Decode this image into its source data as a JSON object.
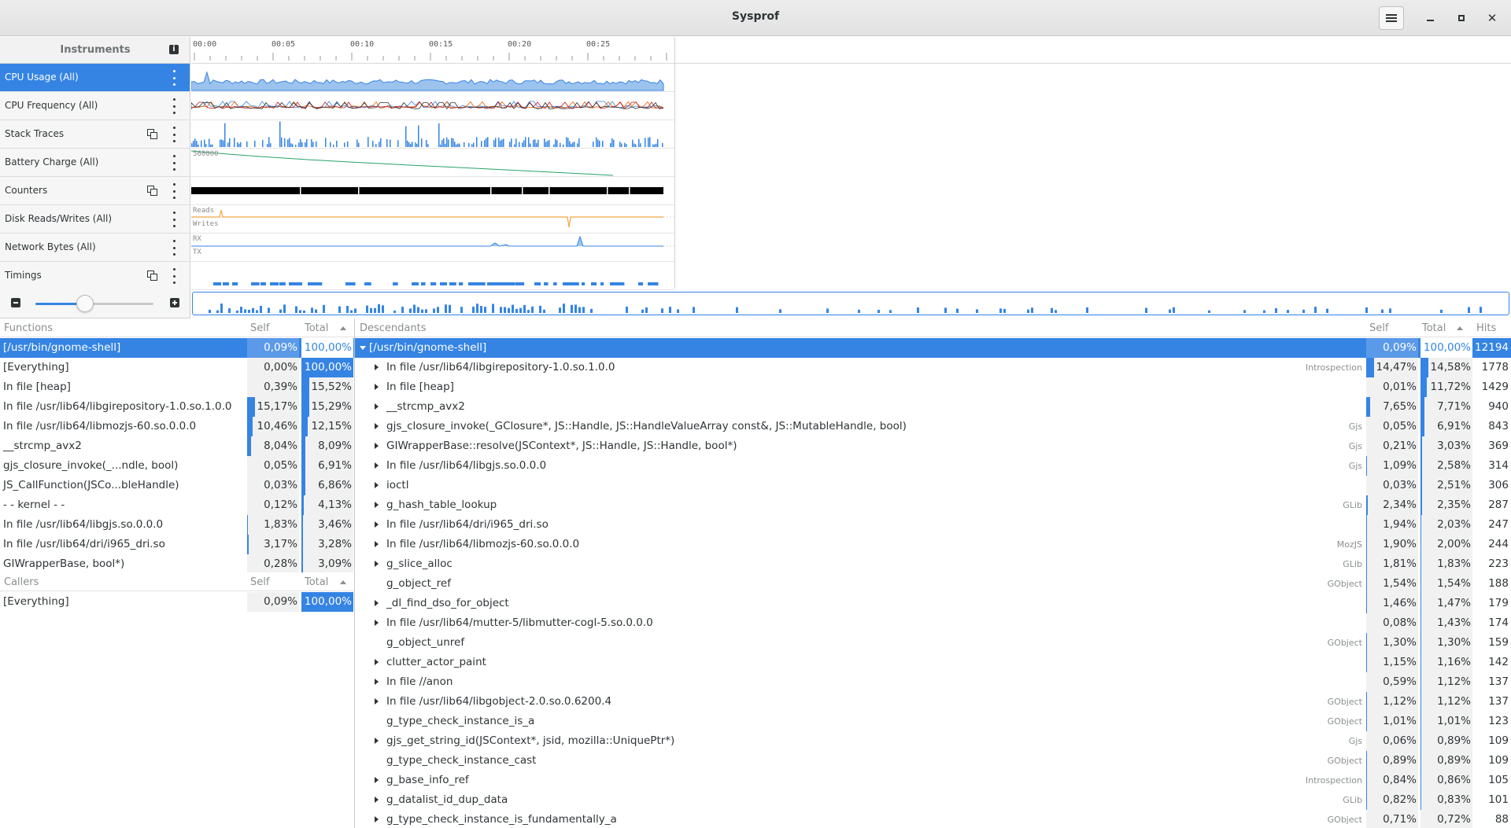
{
  "window": {
    "title": "Sysprof"
  },
  "instruments": {
    "header": "Instruments",
    "rows": [
      {
        "label": "CPU Usage (All)",
        "selected": true,
        "has_dup": false
      },
      {
        "label": "CPU Frequency (All)",
        "selected": false,
        "has_dup": false
      },
      {
        "label": "Stack Traces",
        "selected": false,
        "has_dup": true
      },
      {
        "label": "Battery Charge (All)",
        "selected": false,
        "has_dup": false
      },
      {
        "label": "Counters",
        "selected": false,
        "has_dup": true
      },
      {
        "label": "Disk Reads/Writes (All)",
        "selected": false,
        "has_dup": false
      },
      {
        "label": "Network Bytes (All)",
        "selected": false,
        "has_dup": false
      },
      {
        "label": "Timings",
        "selected": false,
        "has_dup": true
      }
    ]
  },
  "ruler": {
    "ticks": [
      "00:00",
      "00:05",
      "00:10",
      "00:15",
      "00:20",
      "00:25"
    ]
  },
  "graph_labels": {
    "battery": "560000",
    "reads": "Reads",
    "writes": "Writes",
    "rx": "RX",
    "tx": "TX"
  },
  "zoom": {
    "level": 0.42
  },
  "colors": {
    "accent": "#3584e4",
    "battery": "#26a269",
    "disk": "#f5a442"
  },
  "functions": {
    "headers": {
      "name": "Functions",
      "self": "Self",
      "total": "Total"
    },
    "rows": [
      {
        "name": "[/usr/bin/gnome-shell]",
        "self": "0,09%",
        "total": "100,00%",
        "self_f": 0.0009,
        "total_f": 1.0,
        "selected": true
      },
      {
        "name": "[Everything]",
        "self": "0,00%",
        "total": "100,00%",
        "self_f": 0.0,
        "total_f": 1.0,
        "selected": false
      },
      {
        "name": "In file [heap]",
        "self": "0,39%",
        "total": "15,52%",
        "self_f": 0.0039,
        "total_f": 0.1552,
        "selected": false
      },
      {
        "name": "In file /usr/lib64/libgirepository-1.0.so.1.0.0",
        "self": "15,17%",
        "total": "15,29%",
        "self_f": 0.1517,
        "total_f": 0.1529,
        "selected": false
      },
      {
        "name": "In file /usr/lib64/libmozjs-60.so.0.0.0",
        "self": "10,46%",
        "total": "12,15%",
        "self_f": 0.1046,
        "total_f": 0.1215,
        "selected": false
      },
      {
        "name": "__strcmp_avx2",
        "self": "8,04%",
        "total": "8,09%",
        "self_f": 0.0804,
        "total_f": 0.0809,
        "selected": false
      },
      {
        "name": "gjs_closure_invoke(_...ndle<JS::Value>, bool)",
        "self": "0,05%",
        "total": "6,91%",
        "self_f": 0.0005,
        "total_f": 0.0691,
        "selected": false
      },
      {
        "name": "JS_CallFunction(JSCo...bleHandle<JS::Value>)",
        "self": "0,03%",
        "total": "6,86%",
        "self_f": 0.0003,
        "total_f": 0.0686,
        "selected": false
      },
      {
        "name": "- - kernel - -",
        "self": "0,12%",
        "total": "4,13%",
        "self_f": 0.0012,
        "total_f": 0.0413,
        "selected": false
      },
      {
        "name": "In file /usr/lib64/libgjs.so.0.0.0",
        "self": "1,83%",
        "total": "3,46%",
        "self_f": 0.0183,
        "total_f": 0.0346,
        "selected": false
      },
      {
        "name": "In file /usr/lib64/dri/i965_dri.so",
        "self": "3,17%",
        "total": "3,28%",
        "self_f": 0.0317,
        "total_f": 0.0328,
        "selected": false
      },
      {
        "name": "GIWrapperBase<Obje...::Handle<jsid>, bool*)",
        "self": "0,28%",
        "total": "3,09%",
        "self_f": 0.0028,
        "total_f": 0.0309,
        "selected": false
      }
    ]
  },
  "callers": {
    "headers": {
      "name": "Callers",
      "self": "Self",
      "total": "Total"
    },
    "rows": [
      {
        "name": "[Everything]",
        "self": "0,09%",
        "total": "100,00%",
        "self_f": 0.0009,
        "total_f": 1.0,
        "selected": false
      }
    ]
  },
  "descendants": {
    "headers": {
      "name": "Descendants",
      "self": "Self",
      "total": "Total",
      "hits": "Hits"
    },
    "rows": [
      {
        "name": "[/usr/bin/gnome-shell]",
        "lib": "",
        "self": "0,09%",
        "total": "100,00%",
        "hits": "12194",
        "self_f": 0.0009,
        "total_f": 1.0,
        "expand": "open",
        "selected": true
      },
      {
        "name": "In file /usr/lib64/libgirepository-1.0.so.1.0.0",
        "lib": "Introspection",
        "self": "14,47%",
        "total": "14,58%",
        "hits": "1778",
        "self_f": 0.1447,
        "total_f": 0.1458,
        "expand": "closed",
        "selected": false
      },
      {
        "name": "In file [heap]",
        "lib": "",
        "self": "0,01%",
        "total": "11,72%",
        "hits": "1429",
        "self_f": 0.0001,
        "total_f": 0.1172,
        "expand": "closed",
        "selected": false
      },
      {
        "name": "__strcmp_avx2",
        "lib": "",
        "self": "7,65%",
        "total": "7,71%",
        "hits": "940",
        "self_f": 0.0765,
        "total_f": 0.0771,
        "expand": "closed",
        "selected": false
      },
      {
        "name": "gjs_closure_invoke(_GClosure*, JS::Handle<JSObject*>, JS::HandleValueArray const&, JS::MutableHandle<JS::Value>, bool)",
        "lib": "Gjs",
        "self": "0,05%",
        "total": "6,91%",
        "hits": "843",
        "self_f": 0.0005,
        "total_f": 0.0691,
        "expand": "closed",
        "selected": false
      },
      {
        "name": "GIWrapperBase<ObjectBase, ObjectPrototype, ObjectInstance>::resolve(JSContext*, JS::Handle<JSObject*>, JS::Handle<jsid>, bool*)",
        "lib": "Gjs",
        "self": "0,21%",
        "total": "3,03%",
        "hits": "369",
        "self_f": 0.0021,
        "total_f": 0.0303,
        "expand": "closed",
        "selected": false
      },
      {
        "name": "In file /usr/lib64/libgjs.so.0.0.0",
        "lib": "Gjs",
        "self": "1,09%",
        "total": "2,58%",
        "hits": "314",
        "self_f": 0.0109,
        "total_f": 0.0258,
        "expand": "closed",
        "selected": false
      },
      {
        "name": "ioctl",
        "lib": "",
        "self": "0,03%",
        "total": "2,51%",
        "hits": "306",
        "self_f": 0.0003,
        "total_f": 0.0251,
        "expand": "closed",
        "selected": false
      },
      {
        "name": "g_hash_table_lookup",
        "lib": "GLib",
        "self": "2,34%",
        "total": "2,35%",
        "hits": "287",
        "self_f": 0.0234,
        "total_f": 0.0235,
        "expand": "closed",
        "selected": false
      },
      {
        "name": "In file /usr/lib64/dri/i965_dri.so",
        "lib": "",
        "self": "1,94%",
        "total": "2,03%",
        "hits": "247",
        "self_f": 0.0194,
        "total_f": 0.0203,
        "expand": "closed",
        "selected": false
      },
      {
        "name": "In file /usr/lib64/libmozjs-60.so.0.0.0",
        "lib": "MozJS",
        "self": "1,90%",
        "total": "2,00%",
        "hits": "244",
        "self_f": 0.019,
        "total_f": 0.02,
        "expand": "closed",
        "selected": false
      },
      {
        "name": "g_slice_alloc",
        "lib": "GLib",
        "self": "1,81%",
        "total": "1,83%",
        "hits": "223",
        "self_f": 0.0181,
        "total_f": 0.0183,
        "expand": "closed",
        "selected": false
      },
      {
        "name": "g_object_ref",
        "lib": "GObject",
        "self": "1,54%",
        "total": "1,54%",
        "hits": "188",
        "self_f": 0.0154,
        "total_f": 0.0154,
        "expand": "none",
        "selected": false
      },
      {
        "name": "_dl_find_dso_for_object",
        "lib": "",
        "self": "1,46%",
        "total": "1,47%",
        "hits": "179",
        "self_f": 0.0146,
        "total_f": 0.0147,
        "expand": "closed",
        "selected": false
      },
      {
        "name": "In file /usr/lib64/mutter-5/libmutter-cogl-5.so.0.0.0",
        "lib": "",
        "self": "0,08%",
        "total": "1,43%",
        "hits": "174",
        "self_f": 0.0008,
        "total_f": 0.0143,
        "expand": "closed",
        "selected": false
      },
      {
        "name": "g_object_unref",
        "lib": "GObject",
        "self": "1,30%",
        "total": "1,30%",
        "hits": "159",
        "self_f": 0.013,
        "total_f": 0.013,
        "expand": "none",
        "selected": false
      },
      {
        "name": "clutter_actor_paint",
        "lib": "",
        "self": "1,15%",
        "total": "1,16%",
        "hits": "142",
        "self_f": 0.0115,
        "total_f": 0.0116,
        "expand": "closed",
        "selected": false
      },
      {
        "name": "In file //anon",
        "lib": "",
        "self": "0,59%",
        "total": "1,12%",
        "hits": "137",
        "self_f": 0.0059,
        "total_f": 0.0112,
        "expand": "closed",
        "selected": false
      },
      {
        "name": "In file /usr/lib64/libgobject-2.0.so.0.6200.4",
        "lib": "GObject",
        "self": "1,12%",
        "total": "1,12%",
        "hits": "137",
        "self_f": 0.0112,
        "total_f": 0.0112,
        "expand": "closed",
        "selected": false
      },
      {
        "name": "g_type_check_instance_is_a",
        "lib": "GObject",
        "self": "1,01%",
        "total": "1,01%",
        "hits": "123",
        "self_f": 0.0101,
        "total_f": 0.0101,
        "expand": "none",
        "selected": false
      },
      {
        "name": "gjs_get_string_id(JSContext*, jsid, mozilla::UniquePtr<char [], JS::FreePolicy>*)",
        "lib": "Gjs",
        "self": "0,06%",
        "total": "0,89%",
        "hits": "109",
        "self_f": 0.0006,
        "total_f": 0.0089,
        "expand": "closed",
        "selected": false
      },
      {
        "name": "g_type_check_instance_cast",
        "lib": "GObject",
        "self": "0,89%",
        "total": "0,89%",
        "hits": "109",
        "self_f": 0.0089,
        "total_f": 0.0089,
        "expand": "none",
        "selected": false
      },
      {
        "name": "g_base_info_ref",
        "lib": "Introspection",
        "self": "0,84%",
        "total": "0,86%",
        "hits": "105",
        "self_f": 0.0084,
        "total_f": 0.0086,
        "expand": "closed",
        "selected": false
      },
      {
        "name": "g_datalist_id_dup_data",
        "lib": "GLib",
        "self": "0,82%",
        "total": "0,83%",
        "hits": "101",
        "self_f": 0.0082,
        "total_f": 0.0083,
        "expand": "closed",
        "selected": false
      },
      {
        "name": "g_type_check_instance_is_fundamentally_a",
        "lib": "GObject",
        "self": "0,71%",
        "total": "0,72%",
        "hits": "88",
        "self_f": 0.0071,
        "total_f": 0.0072,
        "expand": "closed",
        "selected": false
      }
    ]
  }
}
